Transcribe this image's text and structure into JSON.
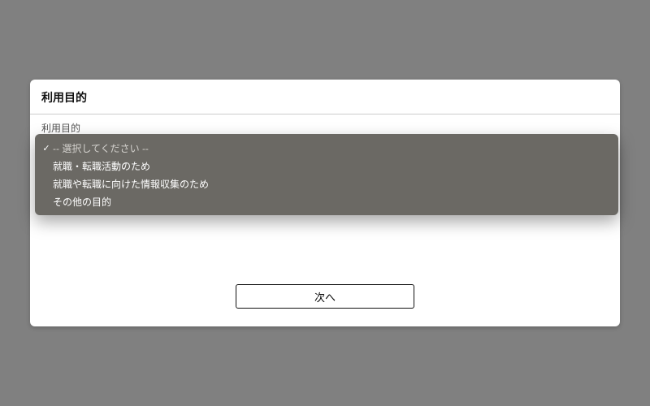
{
  "card": {
    "title": "利用目的",
    "field_label": "利用目的",
    "next_label": "次へ"
  },
  "dropdown": {
    "placeholder": "-- 選択してください --",
    "options": [
      "就職・転職活動のため",
      "就職や転職に向けた情報収集のため",
      "その他の目的"
    ]
  }
}
